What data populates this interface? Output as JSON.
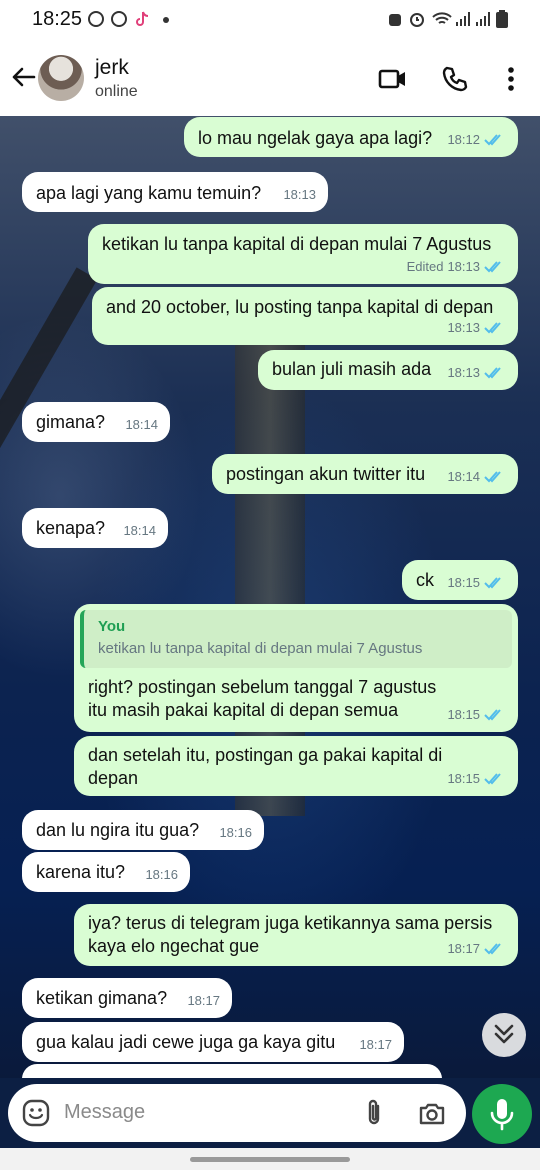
{
  "status_bar": {
    "time": "18:25"
  },
  "header": {
    "name": "jerk",
    "status": "online"
  },
  "messages": [
    {
      "text": "lo mau ngelak gaya apa lagi?",
      "time": "18:12"
    },
    {
      "text": "apa lagi yang kamu temuin?",
      "time": "18:13"
    },
    {
      "text": "ketikan lu tanpa kapital di depan mulai 7 Agustus",
      "edited": "Edited",
      "time": "18:13"
    },
    {
      "text": "and 20 october, lu posting tanpa kapital di depan",
      "time": "18:13"
    },
    {
      "text": "bulan juli masih ada",
      "time": "18:13"
    },
    {
      "text": "gimana?",
      "time": "18:14"
    },
    {
      "text": "postingan akun twitter itu",
      "time": "18:14"
    },
    {
      "text": "kenapa?",
      "time": "18:14"
    },
    {
      "text": "ck",
      "time": "18:15"
    },
    {
      "quote_author": "You",
      "quote_text": "ketikan lu tanpa kapital di depan mulai 7 Agustus",
      "text": "right? postingan sebelum tanggal 7 agustus itu masih pakai kapital di depan semua",
      "time": "18:15"
    },
    {
      "text": "dan setelah itu, postingan ga pakai kapital di depan",
      "time": "18:15"
    },
    {
      "text": "dan lu ngira itu gua?",
      "time": "18:16"
    },
    {
      "text": "karena itu?",
      "time": "18:16"
    },
    {
      "text": "iya? terus di telegram juga ketikannya sama persis kaya elo ngechat gue",
      "time": "18:17"
    },
    {
      "text": "ketikan gimana?",
      "time": "18:17"
    },
    {
      "text": "gua kalau jadi cewe juga ga kaya gitu",
      "time": "18:17"
    }
  ],
  "input": {
    "placeholder": "Message"
  },
  "colors": {
    "outgoing_bubble": "#d9fdd3",
    "incoming_bubble": "#ffffff",
    "read_ticks": "#53bdeb",
    "mic_button": "#1da851"
  },
  "icons": [
    "back-arrow-icon",
    "video-call-icon",
    "phone-icon",
    "more-vert-icon",
    "emoji-icon",
    "attach-icon",
    "camera-icon",
    "mic-icon",
    "scroll-down-icon"
  ]
}
